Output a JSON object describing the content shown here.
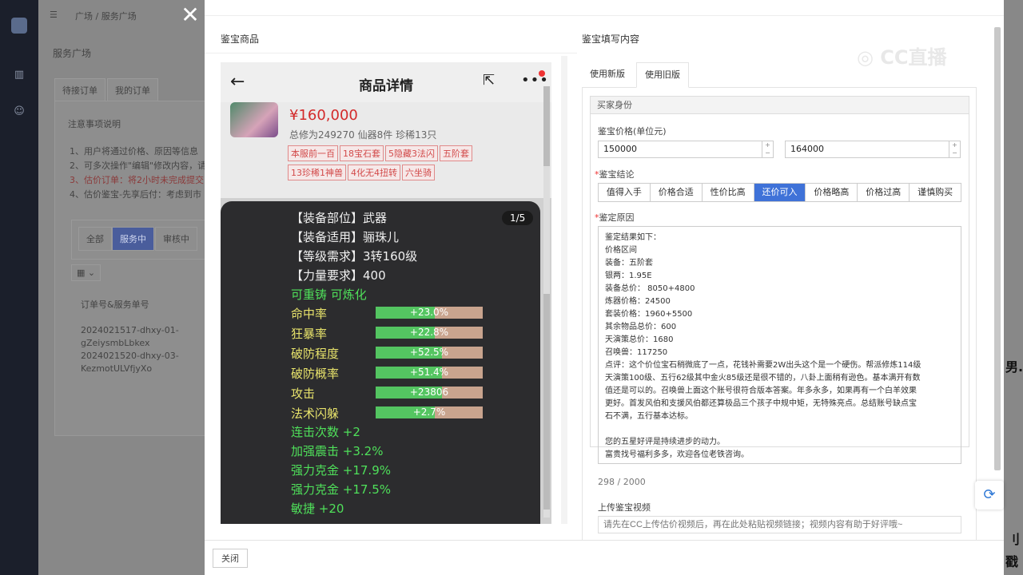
{
  "background": {
    "breadcrumb": [
      "广场",
      "服务广场"
    ],
    "page_title": "服务广场",
    "tabs": [
      "待接订单",
      "我的订单"
    ],
    "notes_title": "注意事项说明",
    "notes": [
      "1、用户将通过价格、原因等信息",
      "2、可多次操作\"编辑\"修改内容，请",
      "3、估价订单：将2小时未完成提交",
      "4、估价鉴宝-先享后付：考虑到市"
    ],
    "filters": [
      "全部",
      "服务中",
      "审核中"
    ],
    "table_header": "订单号&服务单号",
    "orders": [
      "2024021517-dhxy-01-",
      "gZeiysmbLbkex",
      "2024021520-dhxy-03-",
      "KezmotULVfjyXo"
    ]
  },
  "drawer": {
    "left_title": "鉴宝商品",
    "right_title": "鉴宝填写内容",
    "close_label": "关闭"
  },
  "phone": {
    "title": "商品详情",
    "price": "¥160,000",
    "summary": "总修为249270  仙器8件  珍稀13只",
    "tags": [
      "本服前一百",
      "18宝石套",
      "5隐藏3法闪",
      "五阶套",
      "13珍稀1神兽",
      "4化无4扭转",
      "六坐骑"
    ],
    "image_counter": "1/5",
    "attributes": [
      {
        "label": "【装备部位】武器",
        "color": "white"
      },
      {
        "label": "【装备适用】骊珠儿",
        "color": "white"
      },
      {
        "label": "【等级需求】3转160级",
        "color": "white"
      },
      {
        "label": "【力量要求】400",
        "color": "white"
      },
      {
        "label": "可重铸 可炼化",
        "color": "green"
      }
    ],
    "bars": [
      {
        "label": "命中率",
        "value": "+23.0%",
        "fill": 0.55
      },
      {
        "label": "狂暴率",
        "value": "+22.8%",
        "fill": 0.55
      },
      {
        "label": "破防程度",
        "value": "+52.5%",
        "fill": 0.62
      },
      {
        "label": "破防概率",
        "value": "+51.4%",
        "fill": 0.62
      },
      {
        "label": "攻击",
        "value": "+23806",
        "fill": 0.62
      },
      {
        "label": "法术闪躲",
        "value": "+2.7%",
        "fill": 0.55
      }
    ],
    "extras": [
      "连击次数 +2",
      "加强震击 +3.2%",
      "强力克金 +17.9%",
      "强力克金 +17.5%",
      "敏捷 +20"
    ]
  },
  "form": {
    "tabs": [
      "使用新版",
      "使用旧版"
    ],
    "active_tab": 1,
    "group_title": "买家身份",
    "price_label": "鉴宝价格(单位元)",
    "price_min": "150000",
    "price_max": "164000",
    "conclusion_label": "鉴宝结论",
    "conclusions": [
      "值得入手",
      "价格合适",
      "性价比高",
      "还价可入",
      "价格略高",
      "价格过高",
      "谨慎购买"
    ],
    "active_conclusion": 3,
    "reason_label": "鉴定原因",
    "reason_lines": [
      "鉴定结果如下：",
      "价格区间",
      "装备：五阶套",
      "银两：1.95E",
      "装备总价： 8050+4800",
      "炼器价格：24500",
      "套装价格：1960+5500",
      "其余物品总价：600",
      "天演策总价：1680",
      "召唤兽：117250",
      "点评：这个价位宝石稍微底了一点，花钱补需要2W出头这个是一个硬伤。帮派修炼114级",
      "天演策100级、五行62级其中金火85级还是很不错的，八卦上面稍有逊色。基本满开有数",
      "值还是可以的。召唤兽上面这个账号很符合版本答案。年多永多，如果再有一个白羊效果",
      "更好。首发风伯和支援风伯都还算极品三个孩子中规中矩，无特殊亮点。总结账号缺点宝",
      "石不满，五行基本达标。",
      "",
      "您的五星好评是持续进步的动力。",
      "富贵找号福利多多，欢迎各位老铁咨询。"
    ],
    "char_count": "298 / 2000",
    "video_label": "上传鉴宝视频",
    "video_placeholder": "请先在CC上传估价视频后，再在此处粘贴视频链接；视频内容有助于好评哦~"
  },
  "watermark": "CC直播",
  "edge_texts": [
    "男.",
    "刂",
    "戳"
  ],
  "colors": {
    "accent": "#3f72d8",
    "price_red": "#d32a2a",
    "stat_green": "#4fe05a",
    "panel_dark": "#2c2c2e"
  }
}
